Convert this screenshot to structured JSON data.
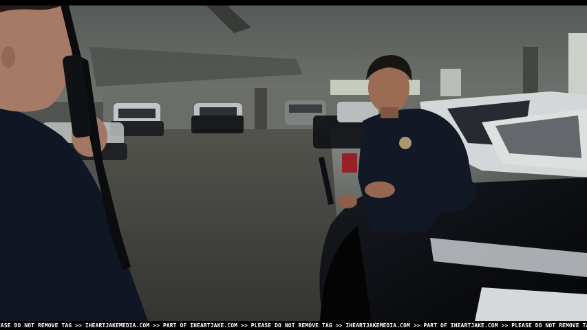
{
  "watermark": {
    "text": "EASE DO NOT REMOVE TAG >> IHEARTJAKEMEDIA.COM >> PART OF IHEARTJAKE.COM >> PLEASE DO NOT REMOVE TAG >> IHEARTJAKEMEDIA.COM >> PART OF IHEARTJAKE.COM >> PLEASE DO NOT REMOVE TAG >> IHEARTJAKE"
  },
  "colors": {
    "letterbox": "#000000",
    "concrete": "#6d6f6a",
    "uniform": "#141a2a",
    "skin": "#b48670",
    "car_black": "#0b0d12",
    "car_white": "#e8ecef"
  }
}
